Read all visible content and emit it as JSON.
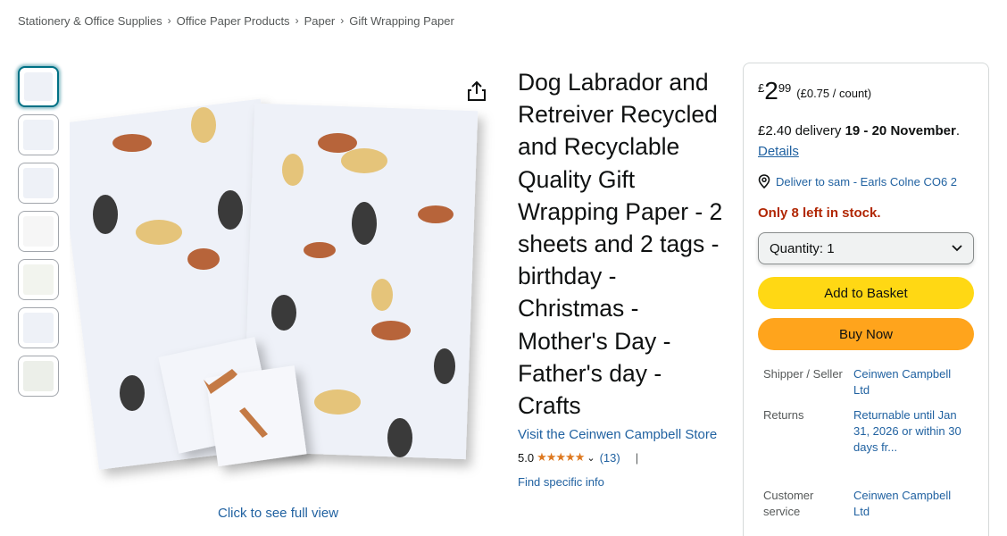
{
  "breadcrumb": [
    "Stationery & Office Supplies",
    "Office Paper Products",
    "Paper",
    "Gift Wrapping Paper"
  ],
  "breadcrumb_separator": "›",
  "gallery": {
    "thumb_count": 7,
    "full_view_label": "Click to see full view"
  },
  "product": {
    "title": "Dog Labrador and Retreiver Recycled and Recyclable Quality Gift Wrapping Paper - 2 sheets and 2 tags - birthday - Christmas - Mother's Day - Father's day - Crafts",
    "store_link": "Visit the Ceinwen Campbell Store",
    "rating": "5.0",
    "stars": "★★★★★",
    "review_count": "(13)",
    "separator": "|",
    "find_info": "Find specific info"
  },
  "buybox": {
    "currency": "£",
    "price_whole": "2",
    "price_fraction": "99",
    "unit_price": "(£0.75 / count)",
    "delivery_prefix": "£2.40 delivery",
    "delivery_dates": "19 - 20 November",
    "delivery_suffix": ".",
    "details_link": "Details",
    "deliver_to": "Deliver to sam - Earls Colne CO6 2",
    "stock": "Only 8 left in stock.",
    "quantity_label": "Quantity: 1",
    "add_to_basket": "Add to Basket",
    "buy_now": "Buy Now",
    "info": [
      {
        "key": "Shipper / Seller",
        "value": "Ceinwen Campbell Ltd"
      },
      {
        "key": "Returns",
        "value": "Returnable until Jan 31, 2026 or within 30 days fr..."
      },
      {
        "key": "Customer service",
        "value": "Ceinwen Campbell Ltd"
      }
    ]
  },
  "colors": {
    "link": "#2162a1",
    "stars": "#de7921",
    "stock": "#b12704",
    "add_button": "#ffd814",
    "buy_button": "#ffa41c"
  }
}
